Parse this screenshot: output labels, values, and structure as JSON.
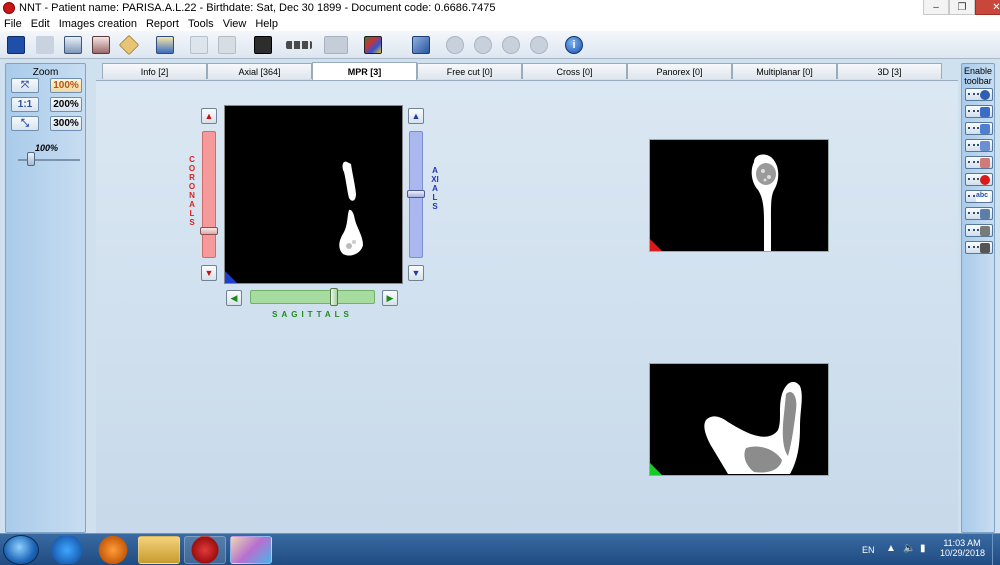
{
  "window": {
    "title": "NNT - Patient name: PARISA.A.L.22 - Birthdate: Sat, Dec 30 1899 - Document code: 0.6686.7475",
    "controls": [
      "–",
      "❐",
      "✕"
    ]
  },
  "menu": [
    "File",
    "Edit",
    "Images creation",
    "Report",
    "Tools",
    "View",
    "Help"
  ],
  "toolbar": {
    "icons": [
      "save-icon",
      "cut-icon",
      "copy-icon",
      "print-preview-icon",
      "eraser-icon",
      "paste-icon",
      "document-icon",
      "printer-icon",
      "stop-icon",
      "layout-icon",
      "rotate-icon",
      "image-icon",
      "edit-icon",
      "first-icon",
      "previous-icon",
      "play-icon",
      "last-icon",
      "info-icon"
    ]
  },
  "zoom_panel": {
    "title": "Zoom",
    "buttons": [
      "100%",
      "200%",
      "300%"
    ],
    "slider_value": "100%"
  },
  "tabs": [
    {
      "label": "Info [2]"
    },
    {
      "label": "Axial [364]"
    },
    {
      "label": "MPR [3]"
    },
    {
      "label": "Free cut [0]"
    },
    {
      "label": "Cross [0]"
    },
    {
      "label": "Panorex [0]"
    },
    {
      "label": "Multiplanar [0]"
    },
    {
      "label": "3D [3]"
    }
  ],
  "active_tab": "MPR [3]",
  "mpr": {
    "coronals_label": "CORONALS",
    "axials_label": "AXIALS",
    "sagittals_label": "SAGITTALS"
  },
  "right_panel": {
    "title_line1": "Enable",
    "title_line2": "toolbar",
    "buttons": [
      "measure-icon",
      "angle-icon",
      "ruler-icon",
      "grid-icon",
      "line-icon",
      "dot-icon",
      "text-abc-icon",
      "layout-icon",
      "draw-icon",
      "hand-icon"
    ]
  },
  "taskbar": {
    "language": "EN",
    "time": "11:03 AM",
    "date": "10/29/2018"
  }
}
